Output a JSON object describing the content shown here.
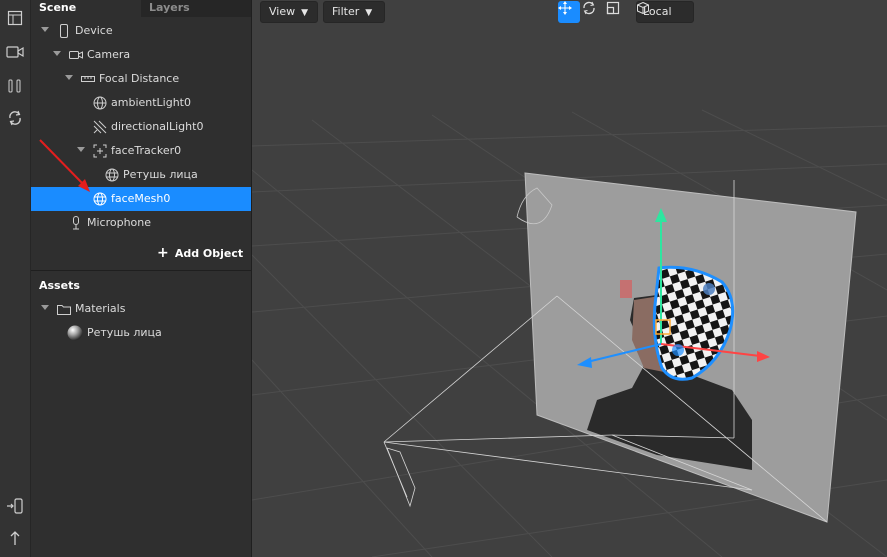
{
  "tabs": {
    "scene": "Scene",
    "layers": "Layers"
  },
  "scene_tree": [
    {
      "label": "Device",
      "icon": "device-icon",
      "expanded": true
    },
    {
      "label": "Camera",
      "icon": "camera-icon",
      "expanded": true
    },
    {
      "label": "Focal Distance",
      "icon": "focal-distance-icon",
      "expanded": true
    },
    {
      "label": "ambientLight0",
      "icon": "globe-light-icon"
    },
    {
      "label": "directionalLight0",
      "icon": "directional-light-icon"
    },
    {
      "label": "faceTracker0",
      "icon": "face-tracker-icon",
      "expanded": true
    },
    {
      "label": "Ретушь лица",
      "icon": "mesh-globe-icon"
    },
    {
      "label": "faceMesh0",
      "icon": "mesh-globe-icon",
      "selected": true
    },
    {
      "label": "Microphone",
      "icon": "microphone-icon"
    }
  ],
  "add_object": {
    "label": "Add Object"
  },
  "assets": {
    "title": "Assets",
    "items": [
      {
        "label": "Materials",
        "icon": "folder-icon",
        "expanded": true
      },
      {
        "label": "Ретушь лица",
        "icon": "material-sphere-icon"
      }
    ]
  },
  "viewport_toolbar": {
    "view_label": "View",
    "filter_label": "Filter",
    "space_label": "Local",
    "active_tool": "move"
  },
  "colors": {
    "selection": "#1a8cff",
    "gizmo_x": "#ff4444",
    "gizmo_y": "#2ee6a0",
    "gizmo_z": "#1e8fff",
    "annotation_arrow": "#e31e1e"
  }
}
